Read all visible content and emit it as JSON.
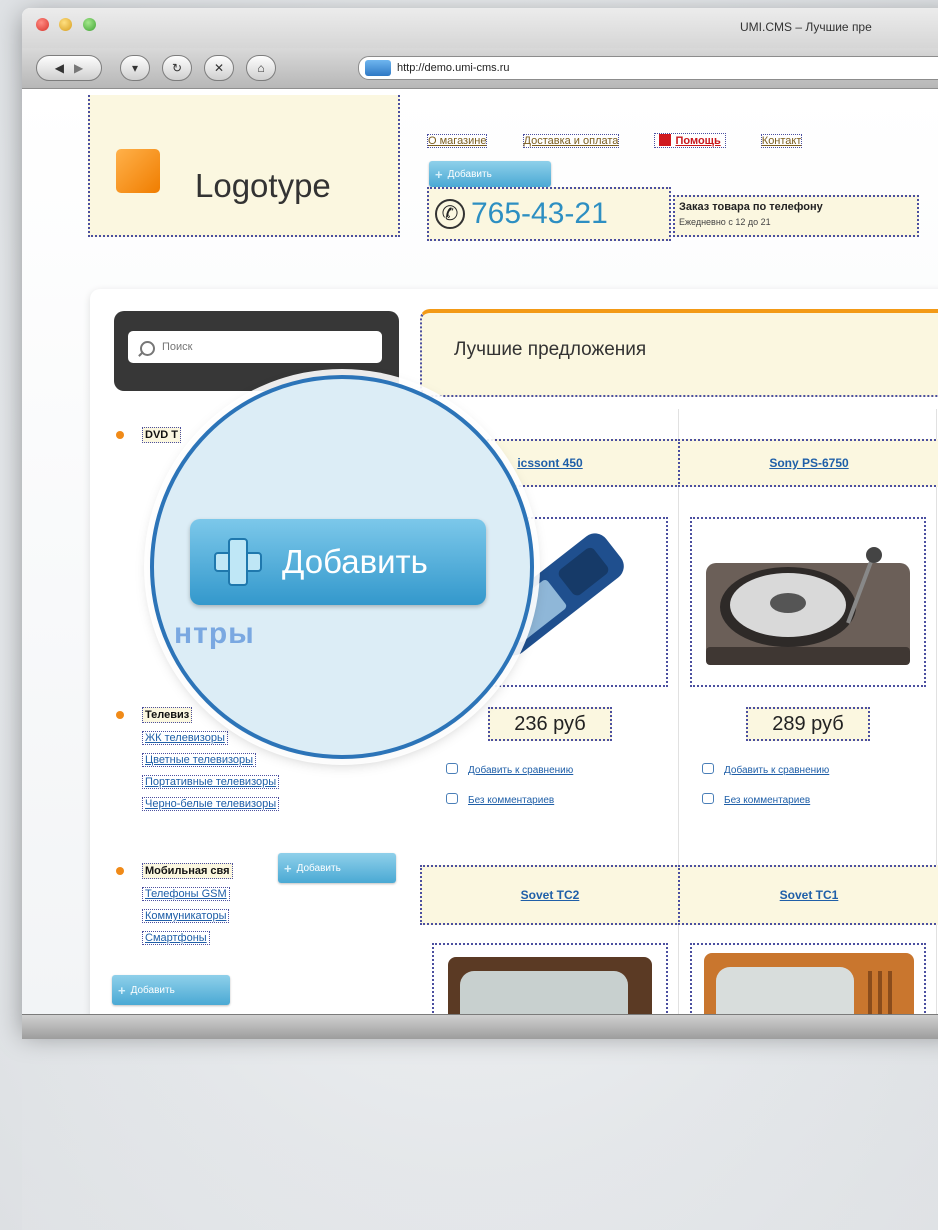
{
  "window": {
    "title": "UMI.CMS – Лучшие пре",
    "url": "http://demo.umi-cms.ru"
  },
  "toolbar": {
    "back_icon": "back-arrow-icon",
    "forward_icon": "forward-arrow-icon",
    "reload_icon": "reload-icon",
    "stop_icon": "stop-icon",
    "home_icon": "home-icon"
  },
  "site": {
    "logo_text": "Logotype",
    "top_links": [
      "О магазине",
      "Доставка и оплата",
      "Помощь",
      "Контакт"
    ],
    "add_label": "Добавить",
    "phone": "765-43-21",
    "order_title": "Заказ товара по телефону",
    "order_hours": "Ежедневно с 12 до 21",
    "search_placeholder": "Поиск",
    "section_title": "Лучшие предложения"
  },
  "categories": [
    {
      "title": "DVD T",
      "items": []
    },
    {
      "title": "Телевиз",
      "items": [
        "ЖК телевизоры",
        "Цветные телевизоры",
        "Портативные телевизоры",
        "Черно-белые телевизоры"
      ]
    },
    {
      "title": "Мобильная свя",
      "items": [
        "Телефоны GSM",
        "Коммуникаторы",
        "Смартфоны"
      ]
    }
  ],
  "products": [
    {
      "name": "icssont 450",
      "price": "236 руб",
      "compare": "Добавить к сравнению",
      "comments": "Без комментариев"
    },
    {
      "name": "Sony PS-6750",
      "price": "289 руб",
      "compare": "Добавить к сравнению",
      "comments": "Без комментариев"
    },
    {
      "name": "Sovet TC2"
    },
    {
      "name": "Sovet TC1"
    }
  ],
  "magnifier": {
    "button_label": "Добавить",
    "ghost_text": "нтры"
  }
}
